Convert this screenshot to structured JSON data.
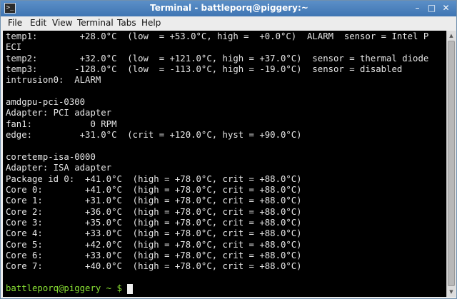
{
  "window": {
    "title": "Terminal - battleporq@piggery:~",
    "icon": "terminal-icon",
    "controls": {
      "minimize": "–",
      "maximize": "□",
      "close": "✕"
    }
  },
  "menu": {
    "items": [
      "File",
      "Edit",
      "View",
      "Terminal",
      "Tabs",
      "Help"
    ]
  },
  "terminal": {
    "lines": [
      "temp1:        +28.0°C  (low  = +53.0°C, high =  +0.0°C)  ALARM  sensor = Intel P",
      "ECI",
      "temp2:        +32.0°C  (low  = +121.0°C, high = +37.0°C)  sensor = thermal diode",
      "temp3:       -128.0°C  (low  = -113.0°C, high = -19.0°C)  sensor = disabled",
      "intrusion0:  ALARM",
      "",
      "amdgpu-pci-0300",
      "Adapter: PCI adapter",
      "fan1:           0 RPM",
      "edge:         +31.0°C  (crit = +120.0°C, hyst = +90.0°C)",
      "",
      "coretemp-isa-0000",
      "Adapter: ISA adapter",
      "Package id 0:  +41.0°C  (high = +78.0°C, crit = +88.0°C)",
      "Core 0:        +41.0°C  (high = +78.0°C, crit = +88.0°C)",
      "Core 1:        +31.0°C  (high = +78.0°C, crit = +88.0°C)",
      "Core 2:        +36.0°C  (high = +78.0°C, crit = +88.0°C)",
      "Core 3:        +35.0°C  (high = +78.0°C, crit = +88.0°C)",
      "Core 4:        +33.0°C  (high = +78.0°C, crit = +88.0°C)",
      "Core 5:        +42.0°C  (high = +78.0°C, crit = +88.0°C)",
      "Core 6:        +33.0°C  (high = +78.0°C, crit = +88.0°C)",
      "Core 7:        +40.0°C  (high = +78.0°C, crit = +88.0°C)"
    ],
    "prompt": "battleporq@piggery ~ $ ",
    "colors": {
      "background": "#000000",
      "foreground": "#e6e6e6",
      "prompt": "#8ae234"
    }
  }
}
